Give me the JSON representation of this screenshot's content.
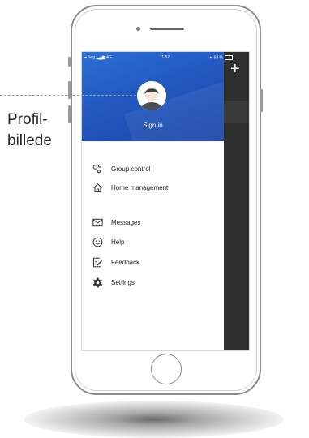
{
  "status_bar": {
    "carrier": "◂ Søg",
    "network": "4G",
    "time": "11.57",
    "battery": "63 %"
  },
  "drawer": {
    "sign_in": "Sign in",
    "menu_group1": [
      {
        "label": "Group control",
        "icon": "group-control-icon"
      },
      {
        "label": "Home management",
        "icon": "home-icon"
      }
    ],
    "menu_group2": [
      {
        "label": "Messages",
        "icon": "envelope-icon"
      },
      {
        "label": "Help",
        "icon": "smiley-icon"
      },
      {
        "label": "Feedback",
        "icon": "feedback-icon"
      },
      {
        "label": "Settings",
        "icon": "gear-icon"
      }
    ]
  },
  "background_screen": {
    "plus": "+"
  },
  "annotation": {
    "line1": "Profil-",
    "line2": "billede"
  },
  "colors": {
    "header_blue": "#2258c0",
    "dark_panel": "#2f2f2f",
    "text": "#222222"
  }
}
